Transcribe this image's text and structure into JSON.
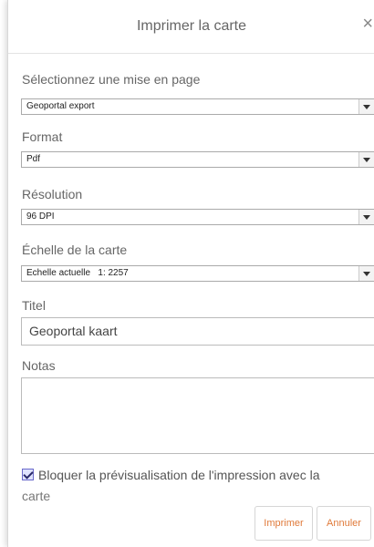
{
  "dialog": {
    "title": "Imprimer la carte",
    "close_symbol": "×",
    "close_icon": "close-icon"
  },
  "layout_field": {
    "label": "Sélectionnez une mise en page",
    "value": "Geoportal export"
  },
  "format_field": {
    "label": "Format",
    "value": "Pdf"
  },
  "resolution_field": {
    "label": "Résolution",
    "value": "96 DPI"
  },
  "scale_field": {
    "label": "Échelle de la carte",
    "value": "Echelle actuelle   1: 2257"
  },
  "title_field": {
    "label": "Titel",
    "value": "Geoportal kaart"
  },
  "notes_field": {
    "label": "Notas",
    "value": ""
  },
  "lock_preview": {
    "checked": true,
    "label_line1": "Bloquer la prévisualisation de l'impression avec la",
    "label_line2": "carte"
  },
  "buttons": {
    "print": "Imprimer",
    "cancel": "Annuler"
  },
  "colors": {
    "button_text": "#e07a3a",
    "checkbox_border": "#6a6acb"
  }
}
